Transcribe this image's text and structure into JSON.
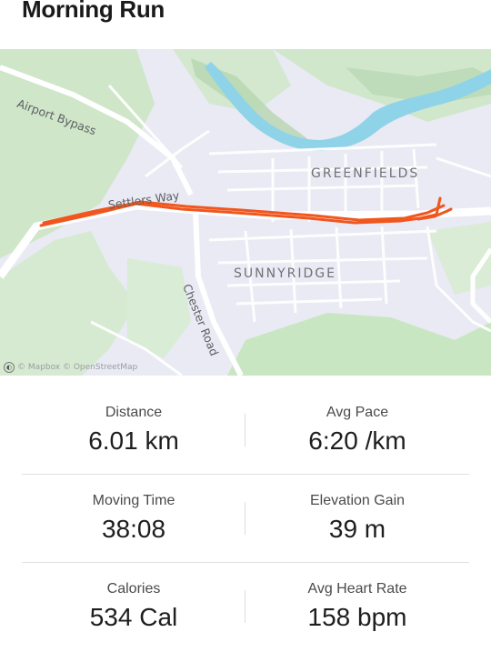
{
  "activity": {
    "title": "Morning Run"
  },
  "map": {
    "labels": {
      "greenfields": "GREENFIELDS",
      "sunnyridge": "SUNNYRIDGE",
      "airport_bypass": "Airport Bypass",
      "chester_road": "Chester Road",
      "settlers_way": "Settlers Way"
    },
    "attribution": "© Mapbox © OpenStreetMap",
    "route_color": "#f0561d",
    "water_color": "#8fd3e8",
    "park_color": "#cfe6c9"
  },
  "stats": [
    [
      {
        "label": "Distance",
        "value": "6.01 km"
      },
      {
        "label": "Avg Pace",
        "value": "6:20 /km"
      }
    ],
    [
      {
        "label": "Moving Time",
        "value": "38:08"
      },
      {
        "label": "Elevation Gain",
        "value": "39 m"
      }
    ],
    [
      {
        "label": "Calories",
        "value": "534 Cal"
      },
      {
        "label": "Avg Heart Rate",
        "value": "158 bpm"
      }
    ]
  ]
}
